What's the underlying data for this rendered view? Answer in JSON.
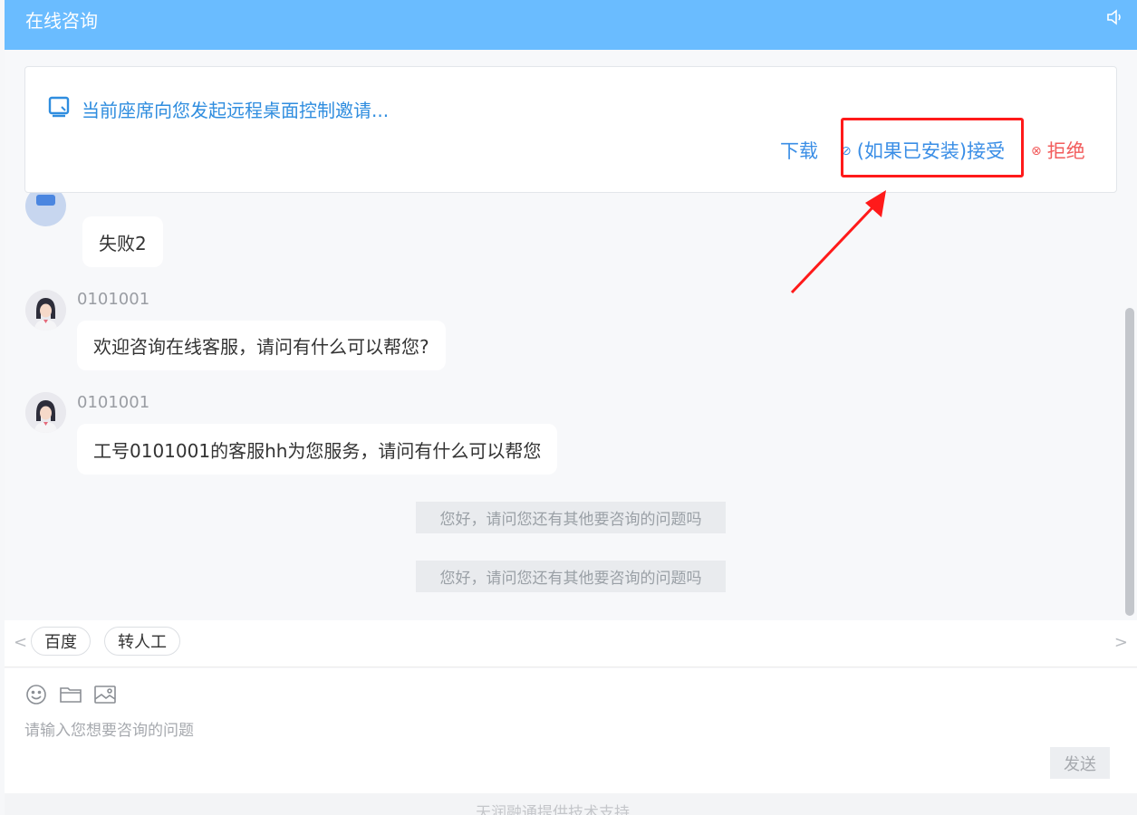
{
  "header": {
    "title": "在线咨询",
    "speaker_icon": "speaker-icon"
  },
  "invite": {
    "message": "当前座席向您发起远程桌面控制邀请...",
    "download_label": "下载",
    "accept_label": "(如果已安装)接受",
    "reject_label": "拒绝",
    "accept_icon": "check-circle-icon",
    "reject_icon": "x-circle-icon"
  },
  "messages": [
    {
      "text": "失败2"
    },
    {
      "sender": "0101001",
      "text": "欢迎咨询在线客服，请问有什么可以帮您?"
    },
    {
      "sender": "0101001",
      "text": "工号0101001的客服hh为您服务，请问有什么可以帮您"
    }
  ],
  "system_messages": [
    "您好，请问您还有其他要咨询的问题吗",
    "您好，请问您还有其他要咨询的问题吗"
  ],
  "quick_replies": [
    "百度",
    "转人工"
  ],
  "nav": {
    "prev": "<",
    "next": ">"
  },
  "input": {
    "placeholder": "请输入您想要咨询的问题",
    "value": ""
  },
  "send_label": "发送",
  "footer": {
    "support": "天润融通提供技术支持"
  },
  "colors": {
    "header": "#6abcff",
    "accent": "#3a8ee6",
    "reject": "#f25c5c",
    "highlight": "#ff1a1a"
  }
}
